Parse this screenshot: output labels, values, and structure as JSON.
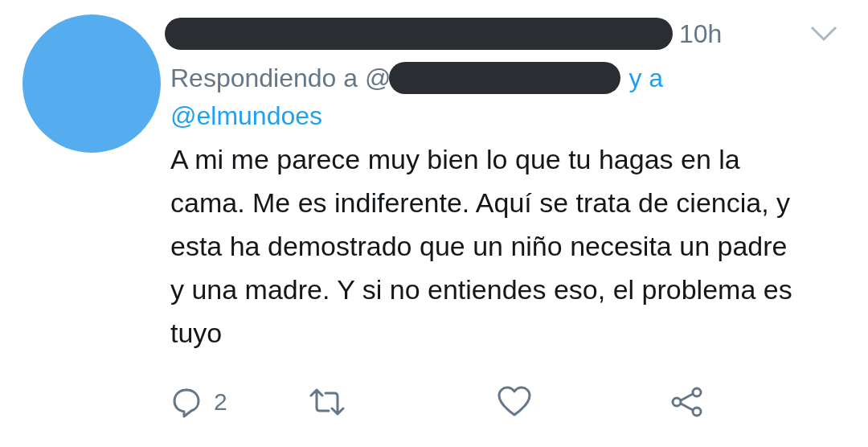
{
  "tweet": {
    "time": "10h",
    "reply_prefix": "Respondiendo a @",
    "reply_joiner": "y a",
    "reply_handle": "@elmundoes",
    "text": "A mi me parece muy bien lo que tu hagas en la cama. Me es indiferente. Aquí se trata de ciencia, y esta ha demostrado que un niño necesita un padre y una madre. Y si no entiendes eso, el problema es tuyo",
    "actions": [
      {
        "kind": "reply",
        "count": "2"
      },
      {
        "kind": "retweet"
      },
      {
        "kind": "like"
      },
      {
        "kind": "share"
      }
    ]
  }
}
